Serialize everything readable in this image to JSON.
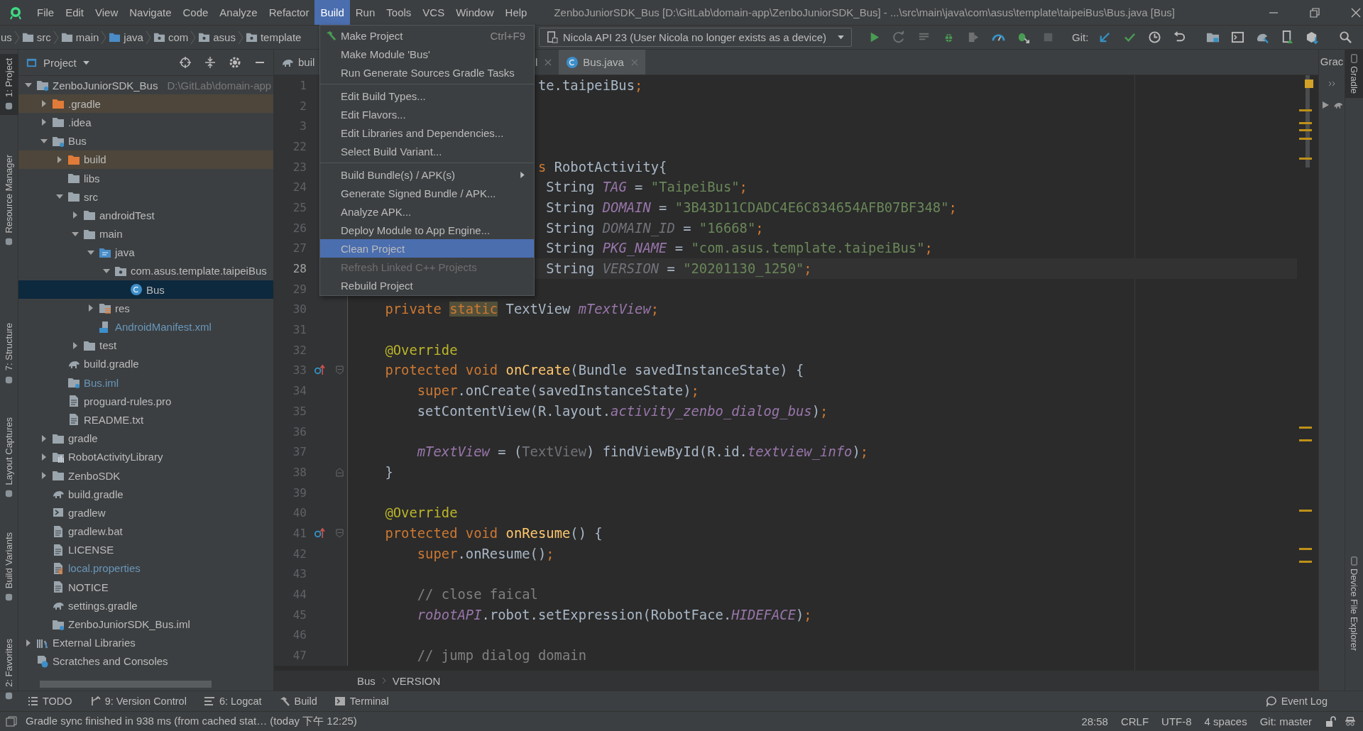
{
  "window": {
    "title": "ZenboJuniorSDK_Bus [D:\\GitLab\\domain-app\\ZenboJuniorSDK_Bus] - ...\\src\\main\\java\\com\\asus\\template\\taipeiBus\\Bus.java [Bus]"
  },
  "menu_bar": [
    {
      "label": "File",
      "selected": false
    },
    {
      "label": "Edit",
      "selected": false
    },
    {
      "label": "View",
      "selected": false
    },
    {
      "label": "Navigate",
      "selected": false
    },
    {
      "label": "Code",
      "selected": false
    },
    {
      "label": "Analyze",
      "selected": false
    },
    {
      "label": "Refactor",
      "selected": false
    },
    {
      "label": "Build",
      "selected": true
    },
    {
      "label": "Run",
      "selected": false
    },
    {
      "label": "Tools",
      "selected": false
    },
    {
      "label": "VCS",
      "selected": false
    },
    {
      "label": "Window",
      "selected": false
    },
    {
      "label": "Help",
      "selected": false
    }
  ],
  "build_menu": [
    {
      "kind": "action",
      "label": "Make Project",
      "shortcut": "Ctrl+F9",
      "selected": false,
      "disabled": false
    },
    {
      "kind": "item",
      "label": "Make Module 'Bus'",
      "selected": false,
      "disabled": false
    },
    {
      "kind": "item",
      "label": "Run Generate Sources Gradle Tasks",
      "selected": false,
      "disabled": false
    },
    {
      "kind": "separator"
    },
    {
      "kind": "item",
      "label": "Edit Build Types...",
      "selected": false,
      "disabled": false
    },
    {
      "kind": "item",
      "label": "Edit Flavors...",
      "selected": false,
      "disabled": false
    },
    {
      "kind": "item",
      "label": "Edit Libraries and Dependencies...",
      "selected": false,
      "disabled": false
    },
    {
      "kind": "item",
      "label": "Select Build Variant...",
      "selected": false,
      "disabled": false
    },
    {
      "kind": "separator"
    },
    {
      "kind": "submenu",
      "label": "Build Bundle(s) / APK(s)",
      "selected": false,
      "disabled": false
    },
    {
      "kind": "item",
      "label": "Generate Signed Bundle / APK...",
      "selected": false,
      "disabled": false
    },
    {
      "kind": "item",
      "label": "Analyze APK...",
      "selected": false,
      "disabled": false
    },
    {
      "kind": "item",
      "label": "Deploy Module to App Engine...",
      "selected": false,
      "disabled": false
    },
    {
      "kind": "item",
      "label": "Clean Project",
      "selected": true,
      "disabled": false
    },
    {
      "kind": "item",
      "label": "Refresh Linked C++ Projects",
      "selected": false,
      "disabled": true
    },
    {
      "kind": "item",
      "label": "Rebuild Project",
      "selected": false,
      "disabled": false
    }
  ],
  "navigation_bar": [
    {
      "label": "us",
      "kind": "text"
    },
    {
      "label": "src",
      "kind": "folder"
    },
    {
      "label": "main",
      "kind": "folder"
    },
    {
      "label": "java",
      "kind": "source-folder"
    },
    {
      "label": "com",
      "kind": "package"
    },
    {
      "label": "asus",
      "kind": "package"
    },
    {
      "label": "template",
      "kind": "package"
    }
  ],
  "run_configuration": {
    "device": "Nicola API 23 (User Nicola no longer exists as a device)"
  },
  "git_label": "Git:",
  "project_panel": {
    "title": "Project"
  },
  "project_tree": [
    {
      "name": "ZenboJuniorSDK_Bus",
      "hint": "D:\\GitLab\\domain-app",
      "kind": "module",
      "excluded": false,
      "modified": false,
      "selected": false,
      "expanded": true,
      "children": [
        {
          "name": ".gradle",
          "kind": "folder",
          "excluded": true,
          "modified": false,
          "selected": false,
          "expanded": false
        },
        {
          "name": ".idea",
          "kind": "folder",
          "excluded": false,
          "modified": false,
          "selected": false,
          "expanded": false
        },
        {
          "name": "Bus",
          "kind": "module",
          "excluded": false,
          "modified": false,
          "selected": false,
          "expanded": true,
          "children": [
            {
              "name": "build",
              "kind": "folder",
              "excluded": true,
              "modified": false,
              "selected": false,
              "expanded": false
            },
            {
              "name": "libs",
              "kind": "folder",
              "excluded": false,
              "modified": false,
              "selected": false
            },
            {
              "name": "src",
              "kind": "folder",
              "excluded": false,
              "modified": false,
              "selected": false,
              "expanded": true,
              "children": [
                {
                  "name": "androidTest",
                  "kind": "folder",
                  "excluded": false,
                  "modified": false,
                  "selected": false,
                  "expanded": false
                },
                {
                  "name": "main",
                  "kind": "folder",
                  "excluded": false,
                  "modified": false,
                  "selected": false,
                  "expanded": true,
                  "children": [
                    {
                      "name": "java",
                      "kind": "source-folder",
                      "excluded": false,
                      "modified": false,
                      "selected": false,
                      "expanded": true,
                      "children": [
                        {
                          "name": "com.asus.template.taipeiBus",
                          "kind": "package",
                          "excluded": false,
                          "modified": false,
                          "selected": false,
                          "expanded": true,
                          "children": [
                            {
                              "name": "Bus",
                              "kind": "class",
                              "excluded": false,
                              "modified": false,
                              "selected": true
                            }
                          ]
                        }
                      ]
                    },
                    {
                      "name": "res",
                      "kind": "resources",
                      "excluded": false,
                      "modified": false,
                      "selected": false,
                      "expanded": false
                    },
                    {
                      "name": "AndroidManifest.xml",
                      "kind": "manifest",
                      "excluded": false,
                      "modified": true,
                      "selected": false
                    }
                  ]
                },
                {
                  "name": "test",
                  "kind": "folder",
                  "excluded": false,
                  "modified": false,
                  "selected": false,
                  "expanded": false
                }
              ]
            },
            {
              "name": "build.gradle",
              "kind": "gradle",
              "excluded": false,
              "modified": false,
              "selected": false
            },
            {
              "name": "Bus.iml",
              "kind": "module-file",
              "excluded": false,
              "modified": true,
              "selected": false
            },
            {
              "name": "proguard-rules.pro",
              "kind": "file",
              "excluded": false,
              "modified": false,
              "selected": false
            },
            {
              "name": "README.txt",
              "kind": "file",
              "excluded": false,
              "modified": false,
              "selected": false
            }
          ]
        },
        {
          "name": "gradle",
          "kind": "folder",
          "excluded": false,
          "modified": false,
          "selected": false,
          "expanded": false
        },
        {
          "name": "RobotActivityLibrary",
          "kind": "library-module",
          "excluded": false,
          "modified": false,
          "selected": false,
          "expanded": false
        },
        {
          "name": "ZenboSDK",
          "kind": "folder",
          "excluded": false,
          "modified": false,
          "selected": false,
          "expanded": false
        },
        {
          "name": "build.gradle",
          "kind": "gradle",
          "excluded": false,
          "modified": false,
          "selected": false
        },
        {
          "name": "gradlew",
          "kind": "script",
          "excluded": false,
          "modified": false,
          "selected": false
        },
        {
          "name": "gradlew.bat",
          "kind": "file",
          "excluded": false,
          "modified": false,
          "selected": false
        },
        {
          "name": "LICENSE",
          "kind": "file",
          "excluded": false,
          "modified": false,
          "selected": false
        },
        {
          "name": "local.properties",
          "kind": "properties",
          "excluded": false,
          "modified": true,
          "selected": false
        },
        {
          "name": "NOTICE",
          "kind": "file",
          "excluded": false,
          "modified": false,
          "selected": false
        },
        {
          "name": "settings.gradle",
          "kind": "gradle",
          "excluded": false,
          "modified": false,
          "selected": false
        },
        {
          "name": "ZenboJuniorSDK_Bus.iml",
          "kind": "module-file",
          "excluded": false,
          "modified": false,
          "selected": false
        }
      ]
    },
    {
      "name": "External Libraries",
      "kind": "libraries",
      "excluded": false,
      "modified": false,
      "selected": false,
      "expanded": false
    },
    {
      "name": "Scratches and Consoles",
      "kind": "scratches",
      "excluded": false,
      "modified": false,
      "selected": false
    }
  ],
  "editor_tabs": [
    {
      "label": "buil",
      "kind": "gradle",
      "selected": false
    },
    {
      "label": "l",
      "kind": "plain",
      "selected": false
    },
    {
      "label": "Bus.java",
      "kind": "class",
      "selected": true
    }
  ],
  "code_lines": [
    {
      "number": "1",
      "current": false,
      "covered": true,
      "tokens": [
        {
          "text": "te.taipeiBus",
          "kind": "plain"
        },
        {
          "text": ";",
          "kind": "keyword"
        }
      ]
    },
    {
      "number": "2",
      "current": false
    },
    {
      "number": "3",
      "current": false
    },
    {
      "number": "22",
      "current": false
    },
    {
      "number": "23",
      "current": false,
      "covered": true,
      "tokens": [
        {
          "text": "s",
          "kind": "keyword"
        },
        {
          "text": " RobotActivity{",
          "kind": "plain"
        }
      ]
    },
    {
      "number": "24",
      "current": false,
      "covered": true,
      "tokens": [
        {
          "text": " String ",
          "kind": "plain"
        },
        {
          "text": "TAG",
          "kind": "constant"
        },
        {
          "text": " = ",
          "kind": "plain"
        },
        {
          "text": "\"TaipeiBus\"",
          "kind": "string"
        },
        {
          "text": ";",
          "kind": "keyword"
        }
      ]
    },
    {
      "number": "25",
      "current": false,
      "covered": true,
      "tokens": [
        {
          "text": " String ",
          "kind": "plain"
        },
        {
          "text": "DOMAIN",
          "kind": "constant"
        },
        {
          "text": " = ",
          "kind": "plain"
        },
        {
          "text": "\"3B43D11CDADC4E6C834654AFB07BF348\"",
          "kind": "string"
        },
        {
          "text": ";",
          "kind": "keyword"
        }
      ]
    },
    {
      "number": "26",
      "current": false,
      "covered": true,
      "tokens": [
        {
          "text": " String ",
          "kind": "plain"
        },
        {
          "text": "DOMAIN_ID",
          "kind": "unused-constant"
        },
        {
          "text": " = ",
          "kind": "plain"
        },
        {
          "text": "\"16668\"",
          "kind": "string"
        },
        {
          "text": ";",
          "kind": "keyword"
        }
      ]
    },
    {
      "number": "27",
      "current": false,
      "covered": true,
      "tokens": [
        {
          "text": " String ",
          "kind": "plain"
        },
        {
          "text": "PKG_NAME",
          "kind": "constant"
        },
        {
          "text": " = ",
          "kind": "plain"
        },
        {
          "text": "\"com.asus.template.taipeiBus\"",
          "kind": "string"
        },
        {
          "text": ";",
          "kind": "keyword"
        }
      ]
    },
    {
      "number": "28",
      "current": true,
      "covered": true,
      "tokens": [
        {
          "text": " String ",
          "kind": "plain"
        },
        {
          "text": "VERSION",
          "kind": "unused-constant"
        },
        {
          "text": " = ",
          "kind": "plain"
        },
        {
          "text": "\"20201130_1250\"",
          "kind": "string"
        },
        {
          "text": ";",
          "kind": "keyword"
        }
      ]
    },
    {
      "number": "29",
      "current": false
    },
    {
      "number": "30",
      "current": false,
      "tokens": [
        {
          "text": "    private ",
          "kind": "keyword"
        },
        {
          "text": "static",
          "kind": "keyword-highlight"
        },
        {
          "text": " TextView ",
          "kind": "plain"
        },
        {
          "text": "mTextView",
          "kind": "constant"
        },
        {
          "text": ";",
          "kind": "keyword"
        }
      ]
    },
    {
      "number": "31",
      "current": false
    },
    {
      "number": "32",
      "current": false,
      "tokens": [
        {
          "text": "    @Override",
          "kind": "annotation"
        }
      ]
    },
    {
      "number": "33",
      "current": false,
      "override": true,
      "fold_start": true,
      "tokens": [
        {
          "text": "    protected void ",
          "kind": "keyword"
        },
        {
          "text": "onCreate",
          "kind": "function"
        },
        {
          "text": "(Bundle savedInstanceState) {",
          "kind": "plain"
        }
      ]
    },
    {
      "number": "34",
      "current": false,
      "tokens": [
        {
          "text": "        super",
          "kind": "keyword"
        },
        {
          "text": ".onCreate(savedInstanceState)",
          "kind": "plain"
        },
        {
          "text": ";",
          "kind": "keyword"
        }
      ]
    },
    {
      "number": "35",
      "current": false,
      "tokens": [
        {
          "text": "        setContentView(R.layout.",
          "kind": "plain"
        },
        {
          "text": "activity_zenbo_dialog_bus",
          "kind": "constant"
        },
        {
          "text": ")",
          "kind": "plain"
        },
        {
          "text": ";",
          "kind": "keyword"
        }
      ]
    },
    {
      "number": "36",
      "current": false
    },
    {
      "number": "37",
      "current": false,
      "tokens": [
        {
          "text": "        mTextView",
          "kind": "constant"
        },
        {
          "text": " = (",
          "kind": "plain"
        },
        {
          "text": "TextView",
          "kind": "unused"
        },
        {
          "text": ") findViewById(R.id.",
          "kind": "plain"
        },
        {
          "text": "textview_info",
          "kind": "constant"
        },
        {
          "text": ")",
          "kind": "plain"
        },
        {
          "text": ";",
          "kind": "keyword"
        }
      ]
    },
    {
      "number": "38",
      "current": false,
      "fold_end": true,
      "tokens": [
        {
          "text": "    }",
          "kind": "plain"
        }
      ]
    },
    {
      "number": "39",
      "current": false
    },
    {
      "number": "40",
      "current": false,
      "tokens": [
        {
          "text": "    @Override",
          "kind": "annotation"
        }
      ]
    },
    {
      "number": "41",
      "current": false,
      "override": true,
      "fold_start": true,
      "tokens": [
        {
          "text": "    protected void ",
          "kind": "keyword"
        },
        {
          "text": "onResume",
          "kind": "function"
        },
        {
          "text": "() {",
          "kind": "plain"
        }
      ]
    },
    {
      "number": "42",
      "current": false,
      "tokens": [
        {
          "text": "        super",
          "kind": "keyword"
        },
        {
          "text": ".onResume()",
          "kind": "plain"
        },
        {
          "text": ";",
          "kind": "keyword"
        }
      ]
    },
    {
      "number": "43",
      "current": false
    },
    {
      "number": "44",
      "current": false,
      "tokens": [
        {
          "text": "        // close faical",
          "kind": "comment"
        }
      ]
    },
    {
      "number": "45",
      "current": false,
      "tokens": [
        {
          "text": "        robotAPI",
          "kind": "constant"
        },
        {
          "text": ".robot.setExpression(RobotFace.",
          "kind": "plain"
        },
        {
          "text": "HIDEFACE",
          "kind": "constant"
        },
        {
          "text": ")",
          "kind": "plain"
        },
        {
          "text": ";",
          "kind": "keyword"
        }
      ]
    },
    {
      "number": "46",
      "current": false
    },
    {
      "number": "47",
      "current": false,
      "tokens": [
        {
          "text": "        // jump dialog domain",
          "kind": "comment"
        }
      ]
    }
  ],
  "breadcrumb": [
    "Bus",
    "VERSION"
  ],
  "gradle_panel": {
    "title": "Grac"
  },
  "left_stripe": [
    {
      "label": "1: Project",
      "selected": true
    },
    {
      "label": "Resource Manager",
      "selected": false
    },
    {
      "label": "7: Structure",
      "selected": false
    },
    {
      "label": "Layout Captures",
      "selected": false
    },
    {
      "label": "Build Variants",
      "selected": false
    },
    {
      "label": "2: Favorites",
      "selected": false
    }
  ],
  "right_stripe": [
    {
      "label": "Gradle",
      "selected": true
    },
    {
      "label": "Device File Explorer",
      "selected": false
    }
  ],
  "tool_windows": [
    {
      "label": "TODO",
      "kind": "todo"
    },
    {
      "label": "9: Version Control",
      "kind": "vcs"
    },
    {
      "label": "6: Logcat",
      "kind": "logcat"
    },
    {
      "label": "Build",
      "kind": "build"
    },
    {
      "label": "Terminal",
      "kind": "terminal"
    }
  ],
  "event_log": "Event Log",
  "status_bar": {
    "message": "Gradle sync finished in 938 ms (from cached stat… (today 下午 12:25)",
    "items": [
      "28:58",
      "CRLF",
      "UTF-8",
      "4 spaces",
      "Git: master"
    ]
  }
}
